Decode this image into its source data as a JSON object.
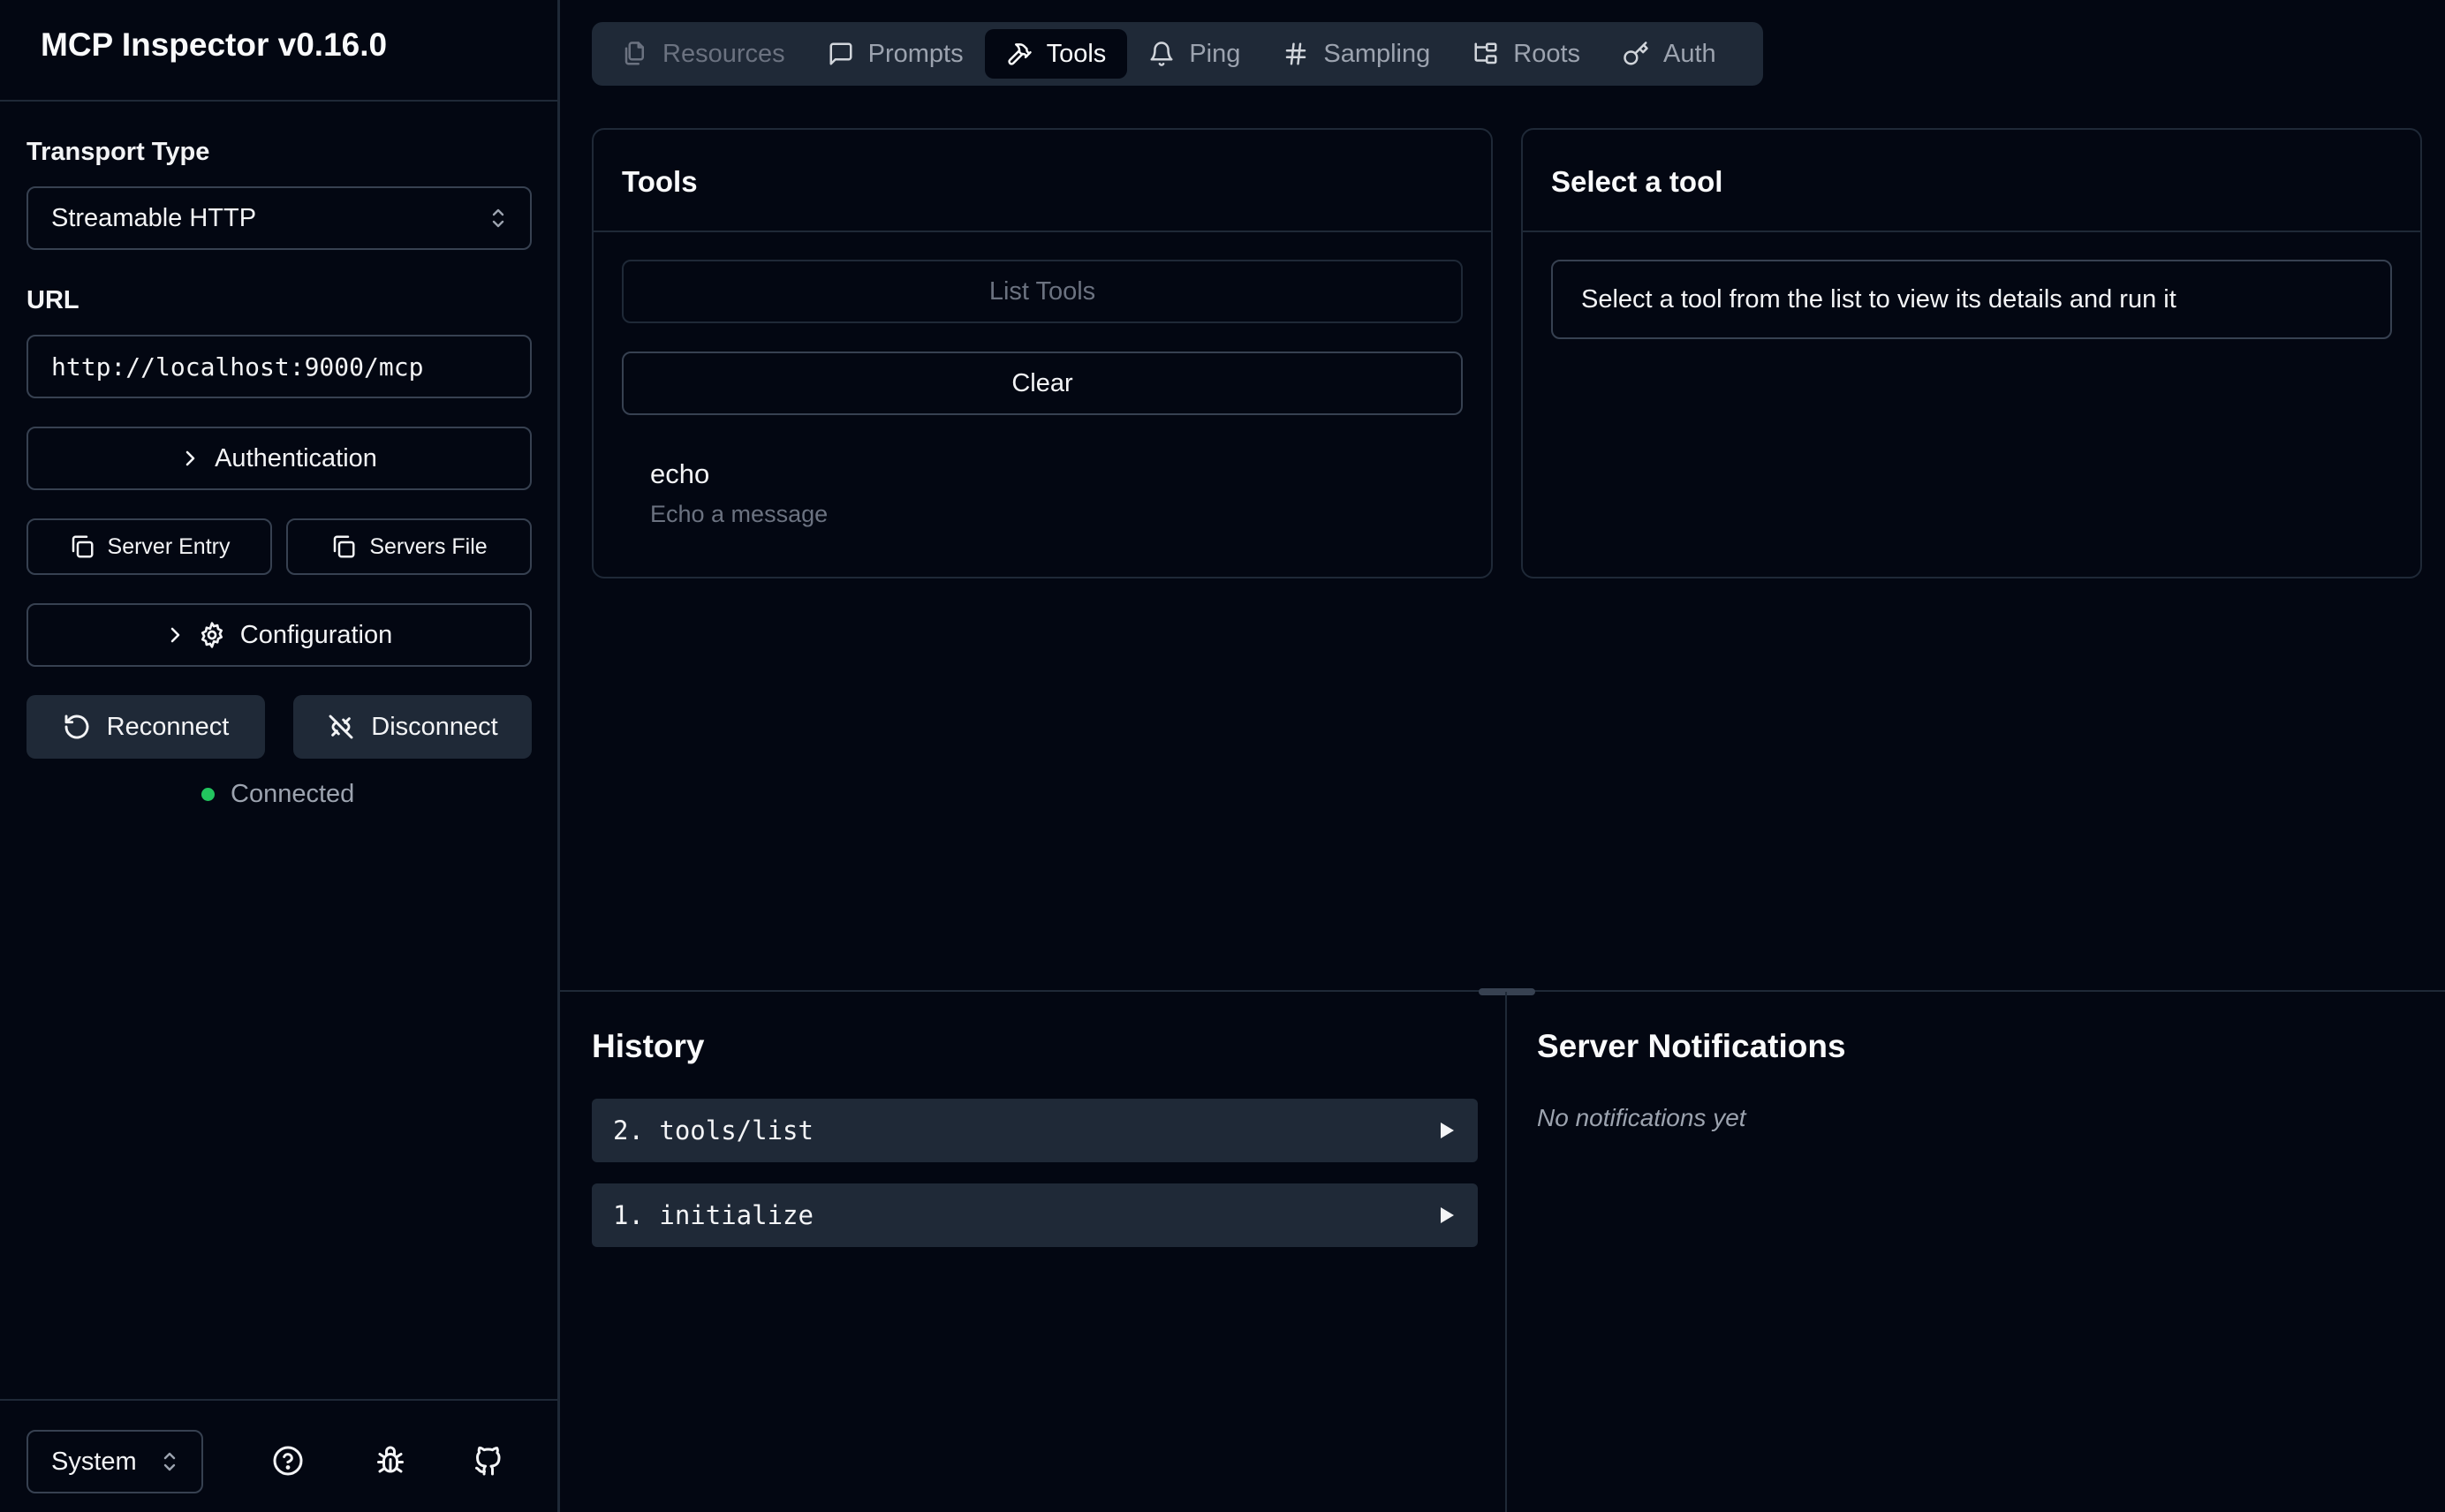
{
  "sidebar": {
    "app_title": "MCP Inspector v0.16.0",
    "transport": {
      "label": "Transport Type",
      "value": "Streamable HTTP"
    },
    "url": {
      "label": "URL",
      "value": "http://localhost:9000/mcp"
    },
    "authentication_label": "Authentication",
    "server_entry_label": "Server Entry",
    "servers_file_label": "Servers File",
    "configuration_label": "Configuration",
    "reconnect_label": "Reconnect",
    "disconnect_label": "Disconnect",
    "status": {
      "text": "Connected",
      "color": "#22c55e"
    },
    "footer": {
      "theme_value": "System",
      "icons": [
        "help-circle-icon",
        "bug-icon",
        "github-icon"
      ]
    }
  },
  "tabs": [
    {
      "label": "Resources",
      "icon": "files-icon",
      "state": "disabled"
    },
    {
      "label": "Prompts",
      "icon": "message-square-icon",
      "state": "normal"
    },
    {
      "label": "Tools",
      "icon": "hammer-icon",
      "state": "active"
    },
    {
      "label": "Ping",
      "icon": "bell-icon",
      "state": "normal"
    },
    {
      "label": "Sampling",
      "icon": "hash-icon",
      "state": "normal"
    },
    {
      "label": "Roots",
      "icon": "folder-tree-icon",
      "state": "normal"
    },
    {
      "label": "Auth",
      "icon": "key-icon",
      "state": "normal"
    }
  ],
  "tools_panel": {
    "title": "Tools",
    "list_button_label": "List Tools",
    "clear_button_label": "Clear",
    "tools": [
      {
        "name": "echo",
        "description": "Echo a message"
      }
    ]
  },
  "detail_panel": {
    "title": "Select a tool",
    "message": "Select a tool from the list to view its details and run it"
  },
  "history": {
    "title": "History",
    "items": [
      {
        "label": "2. tools/list"
      },
      {
        "label": "1. initialize"
      }
    ]
  },
  "notifications": {
    "title": "Server Notifications",
    "empty_text": "No notifications yet"
  }
}
